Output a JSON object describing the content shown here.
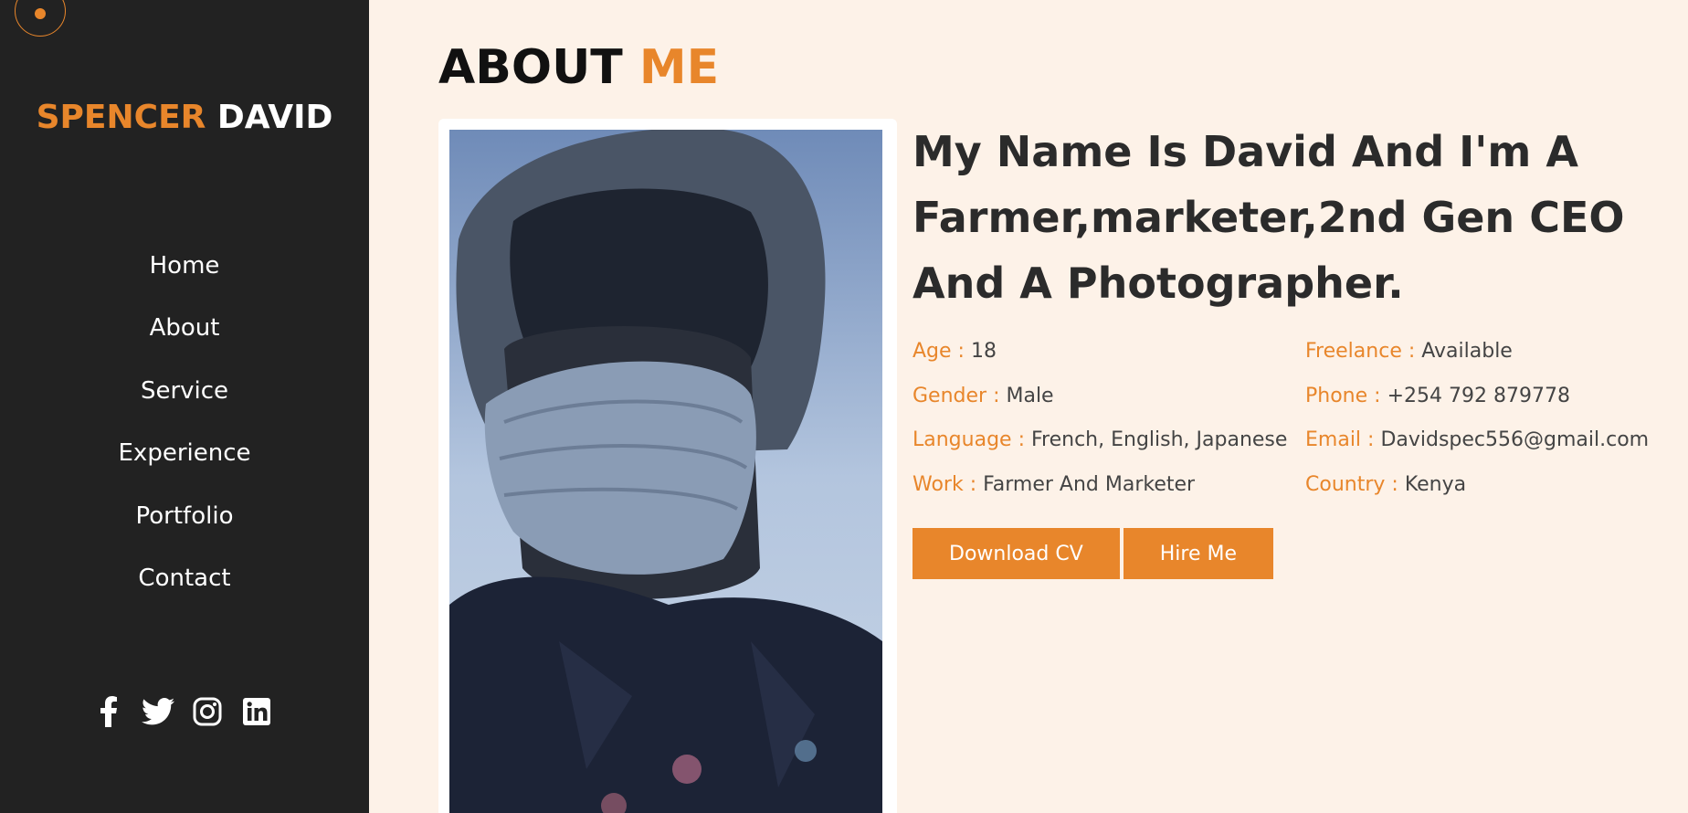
{
  "brand": {
    "first": "SPENCER",
    "last": "DAVID"
  },
  "nav": {
    "items": [
      {
        "label": "Home"
      },
      {
        "label": "About"
      },
      {
        "label": "Service"
      },
      {
        "label": "Experience"
      },
      {
        "label": "Portfolio"
      },
      {
        "label": "Contact"
      }
    ]
  },
  "social": [
    "facebook-icon",
    "twitter-icon",
    "instagram-icon",
    "linkedin-icon"
  ],
  "about": {
    "title_main": "ABOUT",
    "title_accent": "ME",
    "headline": "My Name Is David And I'm A Farmer,marketer,2nd Gen CEO And A Photographer.",
    "facts": [
      {
        "key": "Age :",
        "value": "18"
      },
      {
        "key": "Freelance :",
        "value": "Available"
      },
      {
        "key": "Gender :",
        "value": "Male"
      },
      {
        "key": "Phone :",
        "value": "+254 792 879778"
      },
      {
        "key": "Language :",
        "value": "French, English, Japanese"
      },
      {
        "key": "Email :",
        "value": "Davidspec556@gmail.com"
      },
      {
        "key": "Work :",
        "value": "Farmer And Marketer"
      },
      {
        "key": "Country :",
        "value": "Kenya"
      }
    ],
    "buttons": {
      "download": "Download CV",
      "hire": "Hire Me"
    }
  },
  "colors": {
    "accent": "#e8862b",
    "sidebar": "#222222",
    "background": "#fdf2e8"
  }
}
